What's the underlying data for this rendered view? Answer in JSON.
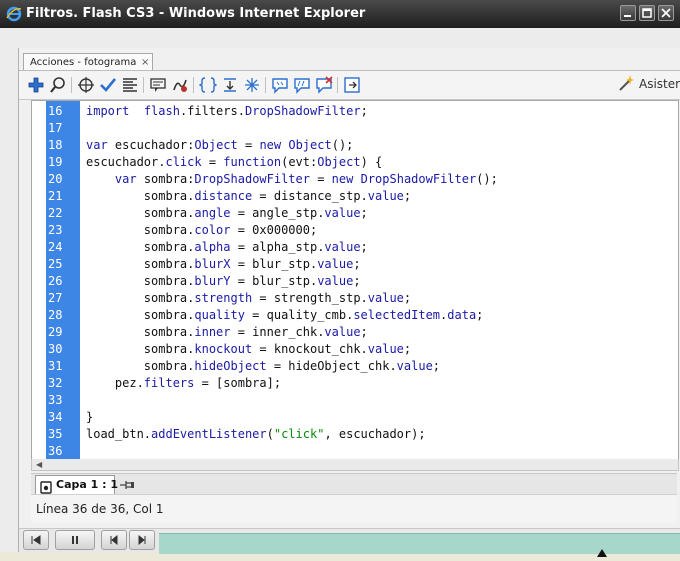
{
  "window": {
    "title": "Filtros. Flash CS3 - Windows Internet Explorer"
  },
  "panel": {
    "tab_label": "Acciones - fotograma",
    "tab_close": "×",
    "assistant_label": "Asister"
  },
  "toolbar": {
    "icons": [
      "add-statement-icon",
      "find-icon",
      "target-path-icon",
      "check-syntax-icon",
      "auto-format-icon",
      "code-hint-icon",
      "debug-options-icon",
      "collapse-braces-icon",
      "collapse-selection-icon",
      "expand-all-icon",
      "apply-block-comment-icon",
      "apply-line-comment-icon",
      "remove-comment-icon",
      "show-hide-toolbox-icon"
    ]
  },
  "code_lines": [
    {
      "n": "16",
      "segs": [
        [
          "kw",
          "import"
        ],
        [
          "",
          "  "
        ],
        [
          "kw",
          "flash"
        ],
        [
          "",
          ".filters."
        ],
        [
          "ty",
          "DropShadowFilter"
        ],
        [
          "",
          ";"
        ]
      ]
    },
    {
      "n": "17",
      "segs": []
    },
    {
      "n": "18",
      "segs": [
        [
          "kw",
          "var"
        ],
        [
          "",
          " escuchador:"
        ],
        [
          "ty",
          "Object"
        ],
        [
          "",
          " = "
        ],
        [
          "kw",
          "new"
        ],
        [
          "",
          " "
        ],
        [
          "ty",
          "Object"
        ],
        [
          "",
          "();"
        ]
      ]
    },
    {
      "n": "19",
      "segs": [
        [
          "",
          "escuchador."
        ],
        [
          "pr",
          "click"
        ],
        [
          "",
          " = "
        ],
        [
          "kw",
          "function"
        ],
        [
          "",
          "(evt:"
        ],
        [
          "ty",
          "Object"
        ],
        [
          "",
          ") {"
        ]
      ]
    },
    {
      "n": "20",
      "segs": [
        [
          "",
          "    "
        ],
        [
          "kw",
          "var"
        ],
        [
          "",
          " sombra:"
        ],
        [
          "ty",
          "DropShadowFilter"
        ],
        [
          "",
          " = "
        ],
        [
          "kw",
          "new"
        ],
        [
          "",
          " "
        ],
        [
          "ty",
          "DropShadowFilter"
        ],
        [
          "",
          "();"
        ]
      ]
    },
    {
      "n": "21",
      "segs": [
        [
          "",
          "        sombra."
        ],
        [
          "pr",
          "distance"
        ],
        [
          "",
          " = distance_stp."
        ],
        [
          "pr",
          "value"
        ],
        [
          "",
          ";"
        ]
      ]
    },
    {
      "n": "22",
      "segs": [
        [
          "",
          "        sombra."
        ],
        [
          "pr",
          "angle"
        ],
        [
          "",
          " = angle_stp."
        ],
        [
          "pr",
          "value"
        ],
        [
          "",
          ";"
        ]
      ]
    },
    {
      "n": "23",
      "segs": [
        [
          "",
          "        sombra."
        ],
        [
          "pr",
          "color"
        ],
        [
          "",
          " = 0x000000;"
        ]
      ]
    },
    {
      "n": "24",
      "segs": [
        [
          "",
          "        sombra."
        ],
        [
          "pr",
          "alpha"
        ],
        [
          "",
          " = alpha_stp."
        ],
        [
          "pr",
          "value"
        ],
        [
          "",
          ";"
        ]
      ]
    },
    {
      "n": "25",
      "segs": [
        [
          "",
          "        sombra."
        ],
        [
          "pr",
          "blurX"
        ],
        [
          "",
          " = blur_stp."
        ],
        [
          "pr",
          "value"
        ],
        [
          "",
          ";"
        ]
      ]
    },
    {
      "n": "26",
      "segs": [
        [
          "",
          "        sombra."
        ],
        [
          "pr",
          "blurY"
        ],
        [
          "",
          " = blur_stp."
        ],
        [
          "pr",
          "value"
        ],
        [
          "",
          ";"
        ]
      ]
    },
    {
      "n": "27",
      "segs": [
        [
          "",
          "        sombra."
        ],
        [
          "pr",
          "strength"
        ],
        [
          "",
          " = strength_stp."
        ],
        [
          "pr",
          "value"
        ],
        [
          "",
          ";"
        ]
      ]
    },
    {
      "n": "28",
      "segs": [
        [
          "",
          "        sombra."
        ],
        [
          "pr",
          "quality"
        ],
        [
          "",
          " = quality_cmb."
        ],
        [
          "pr",
          "selectedItem"
        ],
        [
          "",
          "."
        ],
        [
          "pr",
          "data"
        ],
        [
          "",
          ";"
        ]
      ]
    },
    {
      "n": "29",
      "segs": [
        [
          "",
          "        sombra."
        ],
        [
          "pr",
          "inner"
        ],
        [
          "",
          " = inner_chk."
        ],
        [
          "pr",
          "value"
        ],
        [
          "",
          ";"
        ]
      ]
    },
    {
      "n": "30",
      "segs": [
        [
          "",
          "        sombra."
        ],
        [
          "pr",
          "knockout"
        ],
        [
          "",
          " = knockout_chk."
        ],
        [
          "pr",
          "value"
        ],
        [
          "",
          ";"
        ]
      ]
    },
    {
      "n": "31",
      "segs": [
        [
          "",
          "        sombra."
        ],
        [
          "pr",
          "hideObject"
        ],
        [
          "",
          " = hideObject_chk."
        ],
        [
          "pr",
          "value"
        ],
        [
          "",
          ";"
        ]
      ]
    },
    {
      "n": "32",
      "segs": [
        [
          "",
          "    pez."
        ],
        [
          "pr",
          "filters"
        ],
        [
          "",
          " = [sombra];"
        ]
      ]
    },
    {
      "n": "33",
      "segs": []
    },
    {
      "n": "34",
      "segs": [
        [
          "",
          "}"
        ]
      ]
    },
    {
      "n": "35",
      "segs": [
        [
          "",
          "load_btn."
        ],
        [
          "pr",
          "addEventListener"
        ],
        [
          "",
          "("
        ],
        [
          "str",
          "\"click\""
        ],
        [
          "",
          ", escuchador);"
        ]
      ]
    },
    {
      "n": "36",
      "segs": []
    }
  ],
  "layer": {
    "label": "Capa 1 : 1"
  },
  "status": {
    "text": "Línea 36 de 36, Col 1"
  },
  "colors": {
    "gutter": "#3e86e6",
    "keyword": "#1a1aa6",
    "string": "#0a8a0a",
    "progress": "#a7d6cb"
  }
}
